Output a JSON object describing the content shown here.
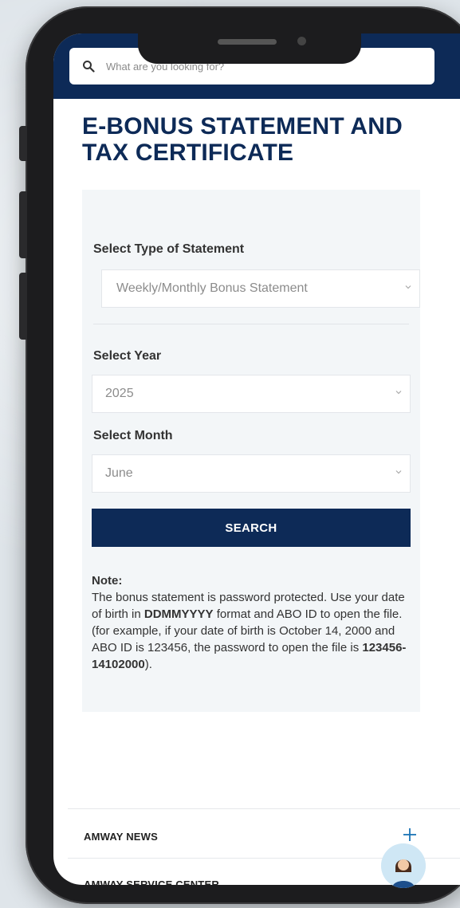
{
  "header": {
    "search_placeholder": "What are you looking for?"
  },
  "page": {
    "title": "E-BONUS STATEMENT AND TAX CERTIFICATE"
  },
  "form": {
    "statement_type": {
      "label": "Select Type of Statement",
      "value": "Weekly/Monthly Bonus Statement"
    },
    "year": {
      "label": "Select Year",
      "value": "2025"
    },
    "month": {
      "label": "Select Month",
      "value": "June"
    },
    "search_label": "SEARCH"
  },
  "note": {
    "title": "Note:",
    "text_1": "The bonus statement is password protected. Use your date of birth in ",
    "format": "DDMMYYYY",
    "text_2": " format and ABO ID to open the file.",
    "text_3": "(for example, if your date of birth is October 14, 2000 and ABO ID is 123456, the password to open the file is ",
    "example_password": "123456-14102000",
    "text_4": ")."
  },
  "footer": {
    "items": [
      {
        "label": "AMWAY NEWS"
      },
      {
        "label": "AMWAY SERVICE CENTER"
      }
    ]
  },
  "colors": {
    "brand_navy": "#0d2a57",
    "panel_bg": "#f3f6f8"
  },
  "icons": {
    "search": "search-icon",
    "chevron": "chevron-down-icon",
    "expand": "plus-icon",
    "assistant": "assistant-avatar-icon"
  }
}
